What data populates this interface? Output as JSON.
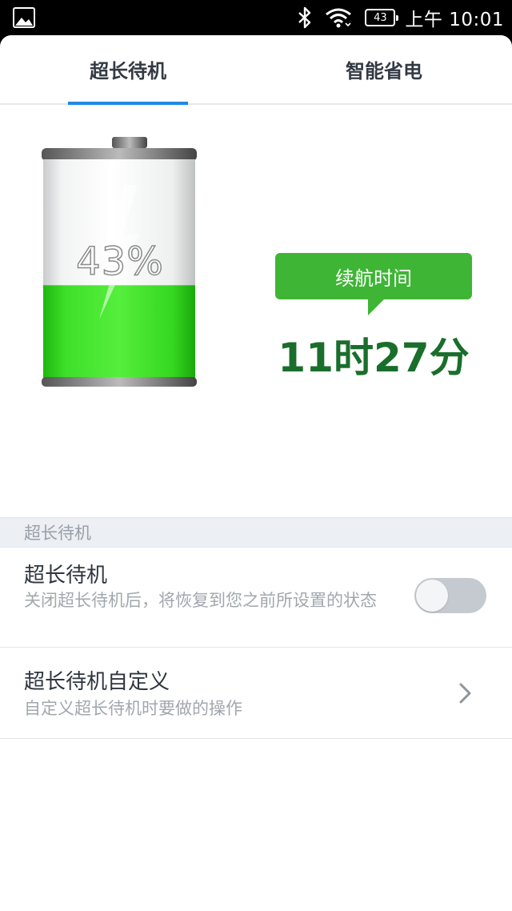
{
  "status_bar": {
    "battery_level": "43",
    "time": "上午 10:01",
    "icons": [
      "gallery-icon",
      "bluetooth-icon",
      "wifi-icon",
      "battery-icon"
    ]
  },
  "tabs": [
    {
      "label": "超长待机",
      "active": true
    },
    {
      "label": "智能省电",
      "active": false
    }
  ],
  "battery": {
    "percent_text": "43%",
    "level": 0.43,
    "fill_color": "#33d81a"
  },
  "endurance": {
    "label": "续航时间",
    "value": "11时27分",
    "bubble_color": "#3eb535",
    "value_color": "#1a6e2c"
  },
  "section": {
    "header": "超长待机"
  },
  "settings": [
    {
      "title": "超长待机",
      "description": "关闭超长待机后，将恢复到您之前所设置的状态",
      "control": "toggle",
      "enabled": false
    },
    {
      "title": "超长待机自定义",
      "description": "自定义超长待机时要做的操作",
      "control": "chevron"
    }
  ],
  "accent_color": "#1e88e5"
}
